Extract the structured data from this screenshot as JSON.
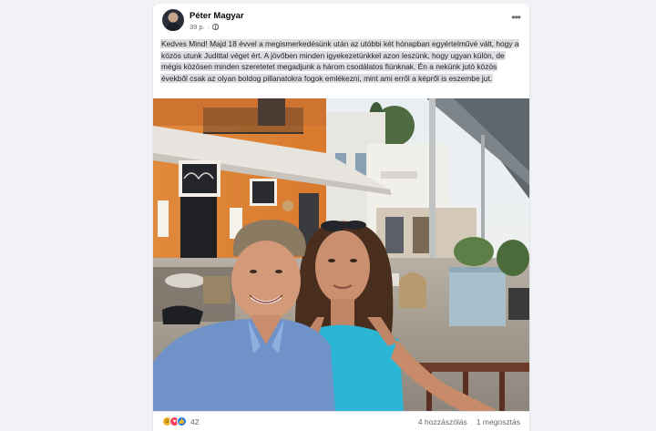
{
  "post": {
    "author": "Péter Magyar",
    "time": "39 p.",
    "text": "Kedves Mind! Majd 18 évvel a megismerkedésünk után az utóbbi két hónapban egyértelművé vált, hogy a közös utunk Judittal véget ért. A jövőben minden igyekezetünkkel azon leszünk, hogy ugyan külön, de mégis közösen minden szeretetet megadjunk a három csodálatos fiúnknak. Én a nekünk jutó közös évekből csak az olyan boldog pillanatokra fogok emlékezni, mint ami erről a képről is eszembe jut."
  },
  "footer": {
    "reaction_count": "42",
    "comments": "4 hozzászólás",
    "shares": "1 megosztás"
  },
  "icons": {
    "audience": "globe-icon",
    "options": "more-icon",
    "reactions": [
      "care-icon",
      "love-icon",
      "like-icon"
    ]
  },
  "colors": {
    "page_bg": "#f0f2f5",
    "text": "#1c1e21",
    "secondary": "#65676b",
    "like_blue": "#1877f2",
    "love_red": "#f33e58"
  }
}
